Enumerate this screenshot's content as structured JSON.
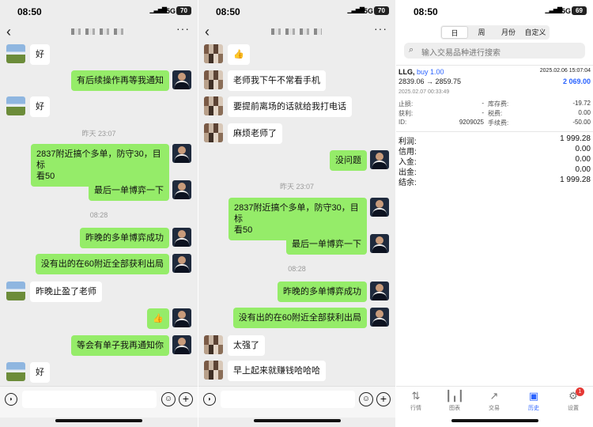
{
  "status": {
    "left": {
      "time": "08:50",
      "network": "5G",
      "battery": "70"
    },
    "middle": {
      "time": "08:50",
      "network": "5G",
      "battery": "70"
    },
    "right": {
      "time": "08:50",
      "network": "5G",
      "battery": "69"
    }
  },
  "chat1": {
    "messages": [
      {
        "text": "好"
      },
      {
        "text": "有后续操作再等我通知"
      },
      {
        "text": "好"
      },
      {
        "text": "昨天 23:07"
      },
      {
        "text": "2837附近搞个多单，防守30，目标\n看50"
      },
      {
        "text": "最后一单博弈一下"
      },
      {
        "text": "08:28"
      },
      {
        "text": "昨晚的多单博弈成功"
      },
      {
        "text": "没有出的在60附近全部获利出局"
      },
      {
        "text": "昨晚止盈了老师"
      },
      {
        "text": "👍"
      },
      {
        "text": "等会有单子我再通知你"
      },
      {
        "text": "好"
      }
    ]
  },
  "chat2": {
    "messages": [
      {
        "text": "👍"
      },
      {
        "text": "老师我下午不常看手机"
      },
      {
        "text": "要提前离场的话就给我打电话"
      },
      {
        "text": "麻烦老师了"
      },
      {
        "text": "没问题"
      },
      {
        "text": "昨天 23:07"
      },
      {
        "text": "2837附近搞个多单，防守30，目标\n看50"
      },
      {
        "text": "最后一单博弈一下"
      },
      {
        "text": "08:28"
      },
      {
        "text": "昨晚的多单博弈成功"
      },
      {
        "text": "没有出的在60附近全部获利出局"
      },
      {
        "text": "太强了"
      },
      {
        "text": "早上起来就赚钱哈哈哈"
      }
    ]
  },
  "history": {
    "tabs": [
      "日",
      "周",
      "月份",
      "自定义"
    ],
    "search_placeholder": "输入交易品种进行搜索",
    "trade": {
      "symbol": "LLG,",
      "side": "buy 1.00",
      "open_time": "2025.02.06 15:07:04",
      "prices": "2839.06 → 2859.75",
      "profit": "2 069.00",
      "close_time": "2025.02.07 00:33:49",
      "sl_label": "止损:",
      "sl_value": "-",
      "tp_label": "获利:",
      "tp_value": "-",
      "id_label": "ID:",
      "id_value": "9209025",
      "swap_label": "库存费:",
      "swap_value": "-19.72",
      "tax_label": "税费:",
      "tax_value": "0.00",
      "fee_label": "手续费:",
      "fee_value": "-50.00"
    },
    "summary": [
      {
        "label": "利润:",
        "value": "1 999.28"
      },
      {
        "label": "信用:",
        "value": "0.00"
      },
      {
        "label": "入金:",
        "value": "0.00"
      },
      {
        "label": "出金:",
        "value": "0.00"
      },
      {
        "label": "结余:",
        "value": "1 999.28"
      }
    ],
    "tabbar": [
      {
        "label": "行情",
        "icon": "quotes-icon"
      },
      {
        "label": "图表",
        "icon": "chart-icon"
      },
      {
        "label": "交易",
        "icon": "trade-icon"
      },
      {
        "label": "历史",
        "icon": "history-icon"
      },
      {
        "label": "设置",
        "icon": "settings-icon"
      }
    ],
    "settings_badge": "1"
  },
  "colors": {
    "out_bubble": "#95ec69",
    "accent_blue": "#2962ff",
    "chat_bg": "#ededed"
  }
}
